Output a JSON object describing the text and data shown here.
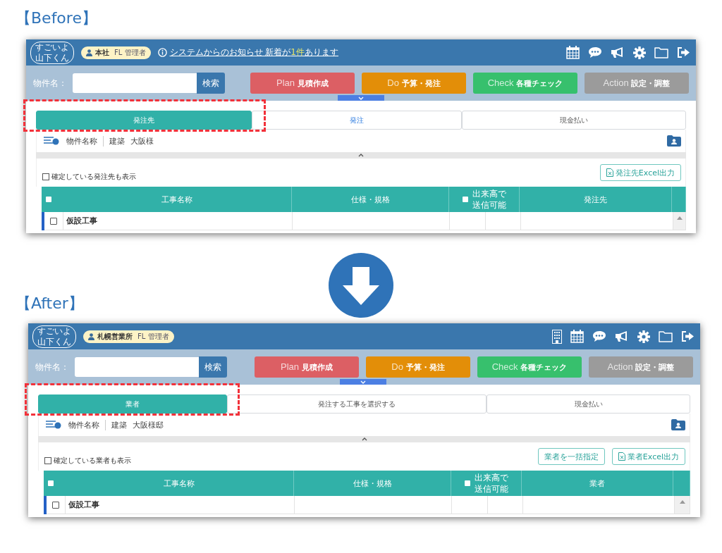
{
  "panels": [
    {
      "heading": "【Before】",
      "screen": {
        "logo": {
          "line1": "すごいよ",
          "line2": "山下くん"
        },
        "user": {
          "office": "本社",
          "role": "FL 管理者"
        },
        "notice": {
          "text": "システムからのお知らせ 新着が",
          "count": "1件",
          "suffix": "あります"
        },
        "header_icons": [
          {
            "kind": "calendar"
          },
          {
            "kind": "chat"
          },
          {
            "kind": "megaphone"
          },
          {
            "kind": "gear"
          },
          {
            "kind": "folder"
          },
          {
            "kind": "logout"
          }
        ],
        "search": {
          "label": "物件名：",
          "button": "検索"
        },
        "phases": [
          {
            "en": "Plan",
            "label": "見積作成",
            "color": "#dc5f64"
          },
          {
            "en": "Do",
            "label": "予算・発注",
            "color": "#e38e08"
          },
          {
            "en": "Check",
            "label": "各種チェック",
            "color": "#37c06d"
          },
          {
            "en": "Action",
            "label": "設定・調整",
            "color": "#9b9b9b"
          }
        ],
        "tabs": [
          {
            "label": "発注先",
            "selected": true,
            "hover": false
          },
          {
            "label": "発注",
            "selected": false,
            "hover": true
          },
          {
            "label": "現金払い",
            "selected": false,
            "hover": false
          }
        ],
        "info": [
          "物件名称",
          "建築",
          "大阪様"
        ],
        "show_confirmed": {
          "label": "確定している発注先も表示",
          "checked": false
        },
        "actions": [
          {
            "kind": "excel",
            "label": "発注先Excel出力"
          }
        ],
        "columns": [
          {
            "kind": "check",
            "checked": false
          },
          {
            "kind": "text",
            "label": "工事名称"
          },
          {
            "kind": "text",
            "label": "仕様・規格"
          },
          {
            "kind": "check-label",
            "label": "出来高で",
            "label2": "送信可能",
            "checked": false
          },
          {
            "kind": "text",
            "label": "発注先"
          }
        ],
        "rows": [
          {
            "name": "仮設工事",
            "checked": false
          }
        ]
      }
    },
    {
      "heading": "【After】",
      "screen": {
        "logo": {
          "line1": "すごいよ",
          "line2": "山下くん"
        },
        "user": {
          "office": "札幌営業所",
          "role": "FL 管理者"
        },
        "header_icons": [
          {
            "kind": "building"
          },
          {
            "kind": "calendar"
          },
          {
            "kind": "chat"
          },
          {
            "kind": "megaphone"
          },
          {
            "kind": "gear"
          },
          {
            "kind": "folder"
          },
          {
            "kind": "logout"
          }
        ],
        "search": {
          "label": "物件名：",
          "button": "検索"
        },
        "phases": [
          {
            "en": "Plan",
            "label": "見積作成",
            "color": "#dc5f64"
          },
          {
            "en": "Do",
            "label": "予算・発注",
            "color": "#e38e08"
          },
          {
            "en": "Check",
            "label": "各種チェック",
            "color": "#37c06d"
          },
          {
            "en": "Action",
            "label": "設定・調整",
            "color": "#9b9b9b"
          }
        ],
        "tabs": [
          {
            "label": "業者",
            "selected": true,
            "hover": false
          },
          {
            "label": "発注する工事を選択する",
            "selected": false,
            "hover": false
          },
          {
            "label": "現金払い",
            "selected": false,
            "hover": false
          }
        ],
        "info": [
          "物件名称",
          "建築",
          "大阪様邸"
        ],
        "show_confirmed": {
          "label": "確定している業者も表示",
          "checked": false
        },
        "actions": [
          {
            "kind": "plain",
            "label": "業者を一括指定"
          },
          {
            "kind": "excel",
            "label": "業者Excel出力"
          }
        ],
        "columns": [
          {
            "kind": "check",
            "checked": false
          },
          {
            "kind": "text",
            "label": "工事名称"
          },
          {
            "kind": "text",
            "label": "仕様・規格"
          },
          {
            "kind": "check-label",
            "label": "出来高で",
            "label2": "送信可能",
            "checked": false
          },
          {
            "kind": "text",
            "label": "業者"
          }
        ],
        "rows": [
          {
            "name": "仮設工事",
            "checked": false
          }
        ]
      }
    }
  ]
}
